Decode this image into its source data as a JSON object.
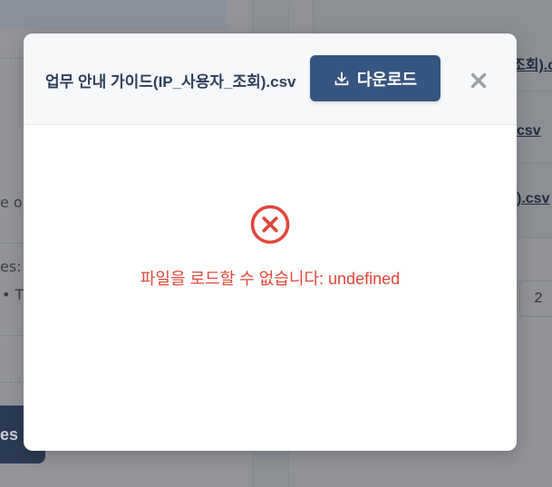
{
  "background": {
    "left_text_1": "e or",
    "left_text_2": "es:",
    "left_text_3": "• T",
    "left_button_label": "es",
    "right_links": [
      "조회).c",
      "csv",
      ").csv"
    ],
    "page_number": "2"
  },
  "modal": {
    "title": "업무 안내 가이드(IP_사용자_조회).csv",
    "download_label": "다운로드",
    "close_icon": "close-icon",
    "error_icon": "error-circle-x-icon",
    "error_message": "파일을 로드할 수 없습니다: undefined"
  },
  "colors": {
    "accent": "#365580",
    "title": "#2f3f5b",
    "error": "#e0473a",
    "close": "#9aa0a8"
  }
}
